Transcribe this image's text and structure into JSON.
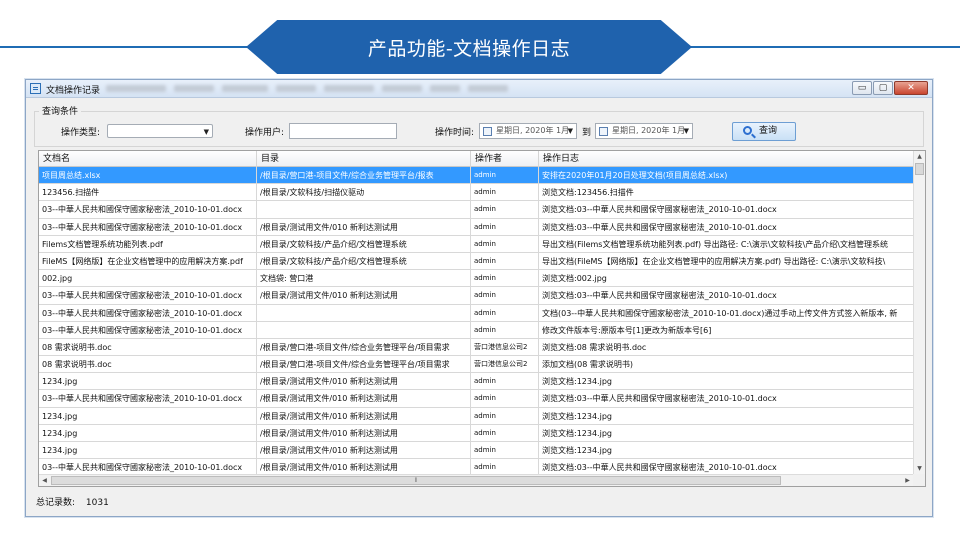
{
  "slide": {
    "title": "产品功能-文档操作日志"
  },
  "window": {
    "title": "文档操作记录",
    "controls": {
      "minimize": "▭",
      "maximize": "▢",
      "close": "✕"
    }
  },
  "query": {
    "group_label": "查询条件",
    "op_type_label": "操作类型:",
    "op_type_value": "",
    "op_user_label": "操作用户:",
    "op_user_value": "",
    "op_time_label": "操作时间:",
    "date_from": "星期日, 2020年 1月",
    "to_label": "到",
    "date_to": "星期日, 2020年 1月",
    "search_label": "查询"
  },
  "table": {
    "columns": [
      "文档名",
      "目录",
      "操作者",
      "操作日志"
    ],
    "rows": [
      [
        "项目周总结.xlsx",
        "/根目录/营口港-项目文件/综合业务管理平台/报表",
        "admin",
        "安排在2020年01月20日处理文档(项目周总结.xlsx)"
      ],
      [
        "123456.扫描件",
        "/根目录/文软科技/扫描仪驱动",
        "admin",
        "浏览文档:123456.扫描件"
      ],
      [
        "03--中華人民共和國保守國家秘密法_2010-10-01.docx",
        "",
        "admin",
        "浏览文档:03--中華人民共和國保守國家秘密法_2010-10-01.docx"
      ],
      [
        "03--中華人民共和國保守國家秘密法_2010-10-01.docx",
        "/根目录/测试用文件/010 新利达测试用",
        "admin",
        "浏览文档:03--中華人民共和國保守國家秘密法_2010-10-01.docx"
      ],
      [
        "Filems文档管理系统功能列表.pdf",
        "/根目录/文软科技/产品介绍/文档管理系统",
        "admin",
        "导出文档(Filems文档管理系统功能列表.pdf) 导出路径: C:\\演示\\文软科技\\产品介绍\\文档管理系统"
      ],
      [
        "FileMS【网络版】在企业文档管理中的应用解决方案.pdf",
        "/根目录/文软科技/产品介绍/文档管理系统",
        "admin",
        "导出文档(FileMS【网络版】在企业文档管理中的应用解决方案.pdf) 导出路径: C:\\演示\\文软科技\\"
      ],
      [
        "002.jpg",
        "文档袋: 营口港",
        "admin",
        "浏览文档:002.jpg"
      ],
      [
        "03--中華人民共和國保守國家秘密法_2010-10-01.docx",
        "/根目录/测试用文件/010 新利达测试用",
        "admin",
        "浏览文档:03--中華人民共和國保守國家秘密法_2010-10-01.docx"
      ],
      [
        "03--中華人民共和國保守國家秘密法_2010-10-01.docx",
        "",
        "admin",
        "文档(03--中華人民共和國保守國家秘密法_2010-10-01.docx)通过手动上传文件方式签入新版本,  新"
      ],
      [
        "03--中華人民共和國保守國家秘密法_2010-10-01.docx",
        "",
        "admin",
        "修改文件版本号:原版本号[1]更改为新版本号[6]"
      ],
      [
        "08 需求说明书.doc",
        "/根目录/营口港-项目文件/综合业务管理平台/项目需求",
        "营口港信息公司2",
        "浏览文档:08 需求说明书.doc"
      ],
      [
        "08 需求说明书.doc",
        "/根目录/营口港-项目文件/综合业务管理平台/项目需求",
        "营口港信息公司2",
        "添加文档(08 需求说明书)"
      ],
      [
        "1234.jpg",
        "/根目录/测试用文件/010 新利达测试用",
        "admin",
        "浏览文档:1234.jpg"
      ],
      [
        "03--中華人民共和國保守國家秘密法_2010-10-01.docx",
        "/根目录/测试用文件/010 新利达测试用",
        "admin",
        "浏览文档:03--中華人民共和國保守國家秘密法_2010-10-01.docx"
      ],
      [
        "1234.jpg",
        "/根目录/测试用文件/010 新利达测试用",
        "admin",
        "浏览文档:1234.jpg"
      ],
      [
        "1234.jpg",
        "/根目录/测试用文件/010 新利达测试用",
        "admin",
        "浏览文档:1234.jpg"
      ],
      [
        "1234.jpg",
        "/根目录/测试用文件/010 新利达测试用",
        "admin",
        "浏览文档:1234.jpg"
      ],
      [
        "03--中華人民共和國保守國家秘密法_2010-10-01.docx",
        "/根目录/测试用文件/010 新利达测试用",
        "admin",
        "浏览文档:03--中華人民共和國保守國家秘密法_2010-10-01.docx"
      ]
    ],
    "hscroll_thumb": "⦀"
  },
  "footer": {
    "total_label": "总记录数:",
    "total_value": "1031"
  }
}
